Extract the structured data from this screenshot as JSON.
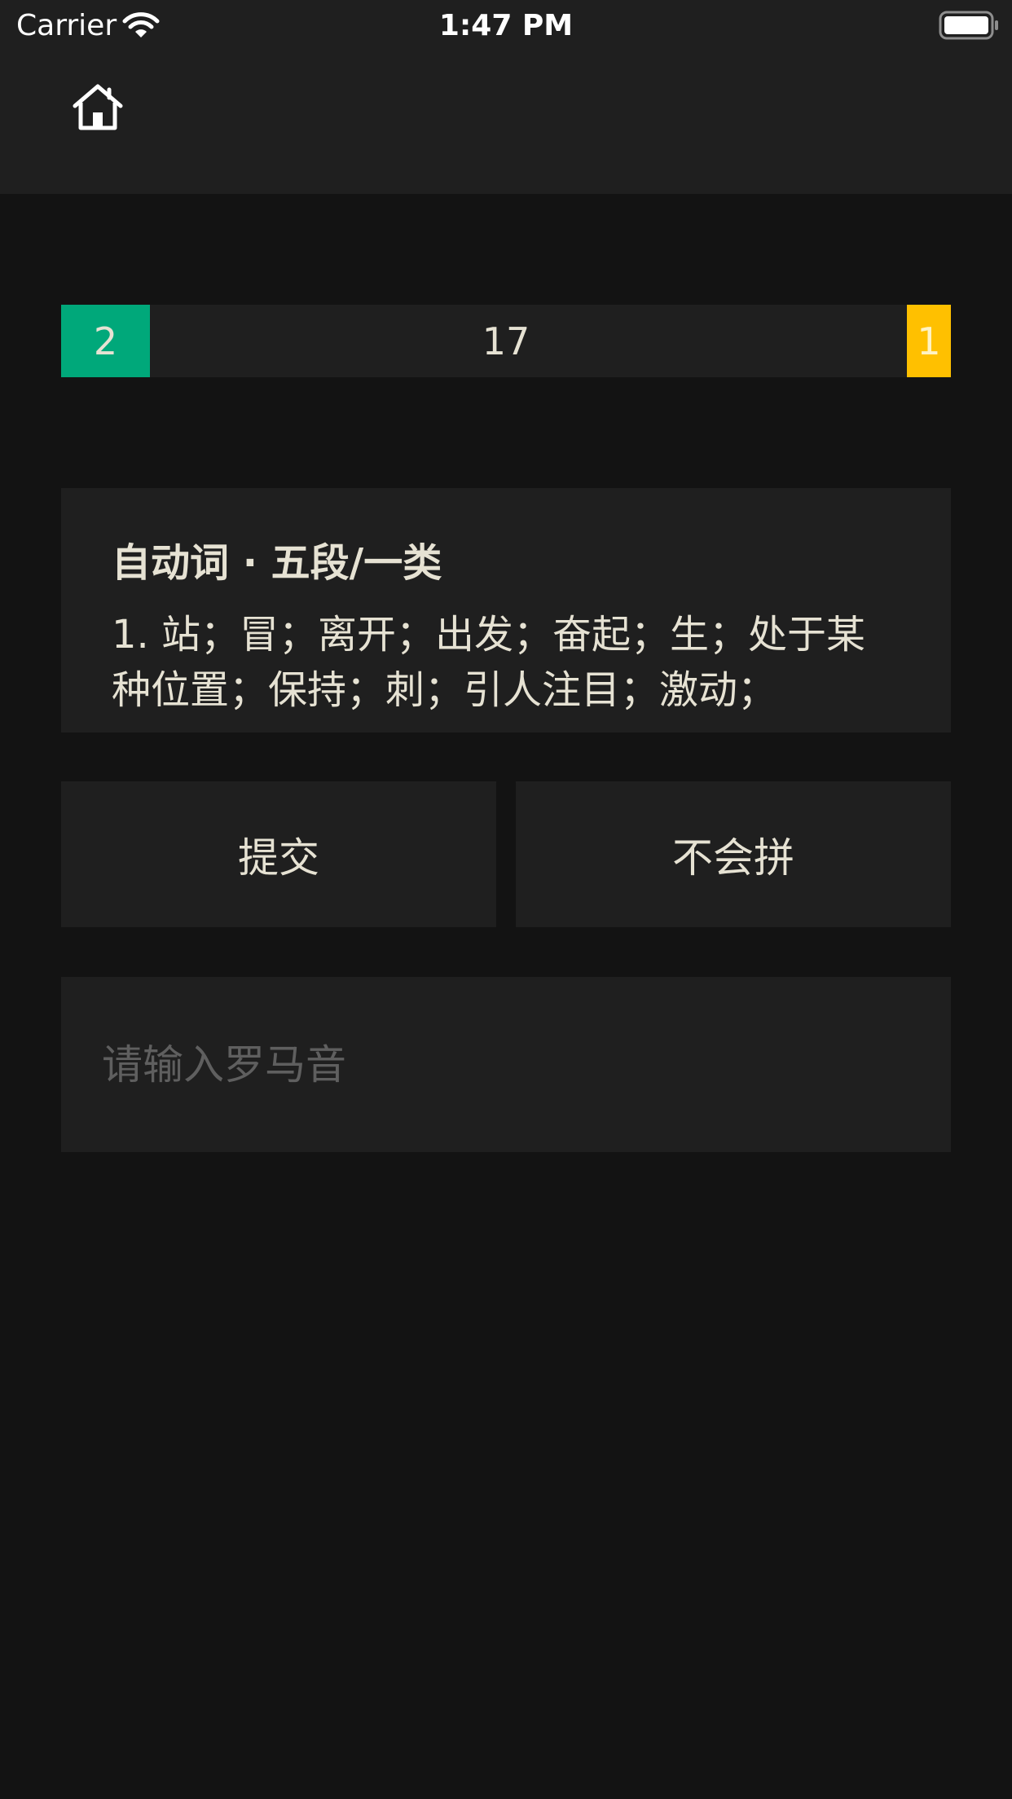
{
  "status_bar": {
    "carrier": "Carrier",
    "time": "1:47 PM",
    "wifi_icon": "wifi-icon",
    "battery_icon": "battery-full-icon"
  },
  "nav": {
    "home_icon": "home-icon"
  },
  "progress": {
    "correct": "2",
    "remaining": "17",
    "wrong": "1",
    "correct_color": "#00a87a",
    "wrong_color": "#ffc000"
  },
  "card": {
    "part_of_speech": "自动词 · 五段/一类",
    "definition": "1. 站；冒；离开；出发；奋起；生；处于某种位置；保持；刺；引人注目；激动；"
  },
  "buttons": {
    "submit_label": "提交",
    "skip_label": "不会拼"
  },
  "input": {
    "value": "",
    "placeholder": "请输入罗马音"
  },
  "colors": {
    "background": "#131313",
    "surface": "#1f1f1f",
    "text": "#e6e2d3"
  }
}
